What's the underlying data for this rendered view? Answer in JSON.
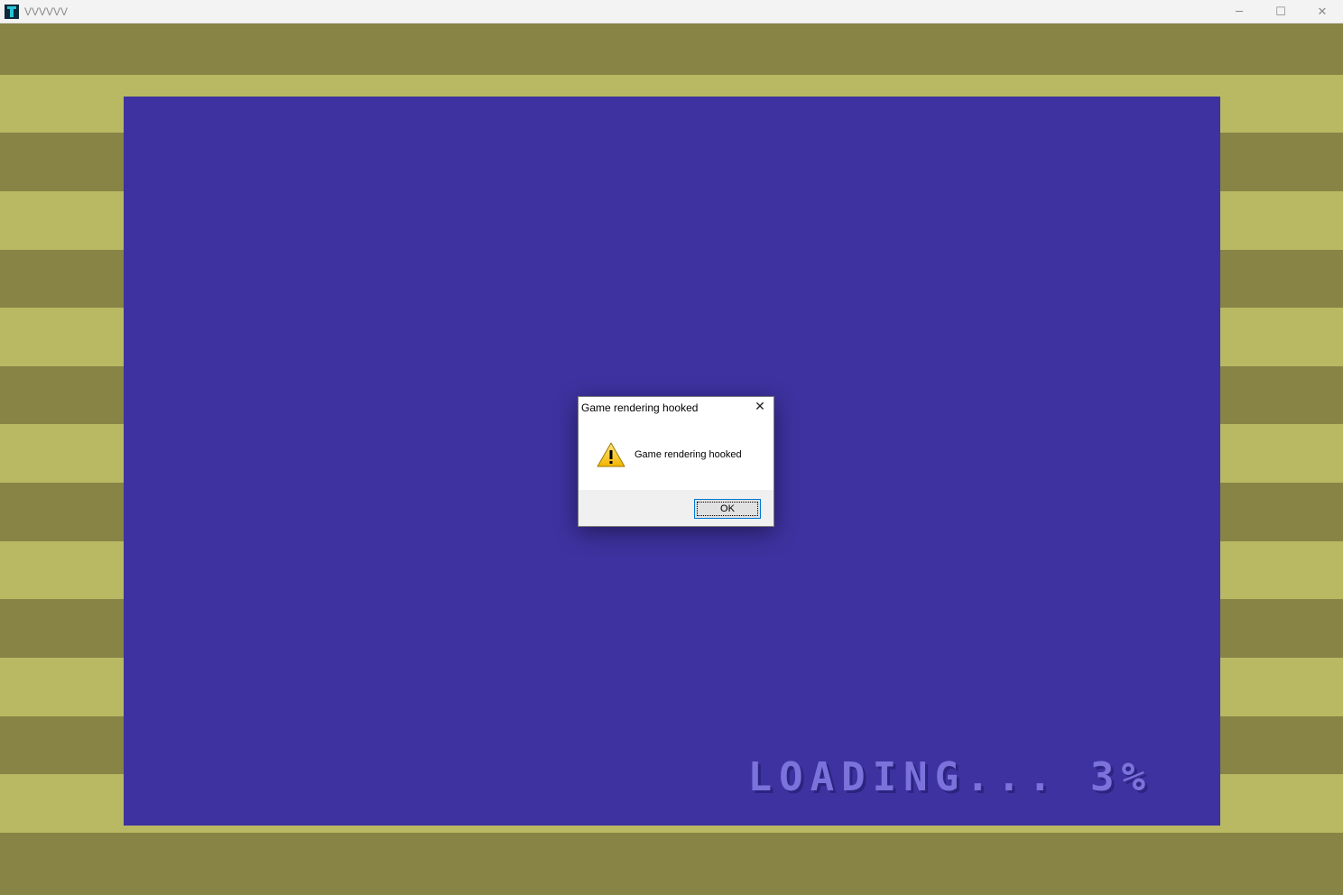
{
  "window": {
    "title": "VVVVVV",
    "controls": {
      "minimize": "─",
      "maximize": "☐",
      "close": "✕"
    }
  },
  "game": {
    "loading_text": "LOADING... 3%",
    "loading_progress_percent": 3,
    "colors": {
      "stripe_dark": "#878446",
      "stripe_light": "#b8b962",
      "screen": "#3e32a0",
      "loading_text": "#7b72dc"
    }
  },
  "dialog": {
    "title": "Game rendering hooked",
    "message": "Game rendering hooked",
    "icon": "warning-icon",
    "close_glyph": "✕",
    "ok_label": "OK"
  }
}
